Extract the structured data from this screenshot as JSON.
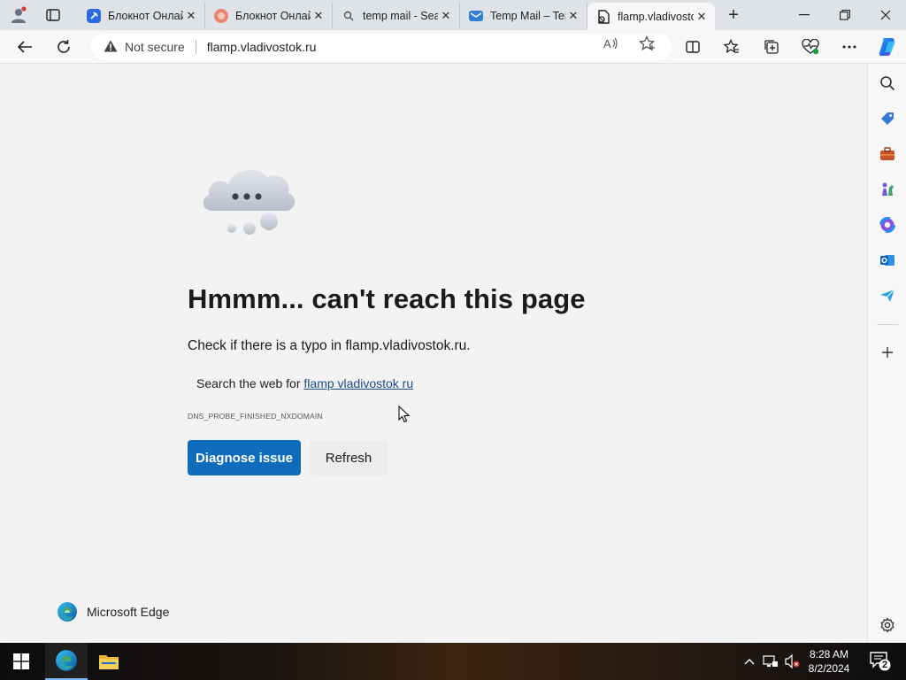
{
  "browser": {
    "tabs": [
      {
        "title": "Блокнот Онлайн",
        "favicon": "blue-note-icon"
      },
      {
        "title": "Блокнот Онлайн",
        "favicon": "orange-note-icon"
      },
      {
        "title": "temp mail - Search",
        "favicon": "search-icon"
      },
      {
        "title": "Temp Mail – Temp",
        "favicon": "temp-mail-icon"
      },
      {
        "title": "flamp.vladivostok.ru",
        "favicon": "error-page-icon",
        "active": true
      }
    ],
    "address": {
      "security_label": "Not secure",
      "url": "flamp.vladivostok.ru"
    }
  },
  "error_page": {
    "title": "Hmmm... can't reach this page",
    "check_text": "Check if there is a typo in flamp.vladivostok.ru.",
    "search_prefix": "Search the web for",
    "search_link": "flamp vladivostok ru",
    "error_code": "DNS_PROBE_FINISHED_NXDOMAIN",
    "diagnose_label": "Diagnose issue",
    "refresh_label": "Refresh",
    "brand": "Microsoft Edge"
  },
  "taskbar": {
    "time": "8:28 AM",
    "date": "8/2/2024",
    "notification_count": "2"
  },
  "colors": {
    "accent": "#0f6cbd",
    "link": "#1a4d8f",
    "page_bg": "#f3f3f3"
  }
}
